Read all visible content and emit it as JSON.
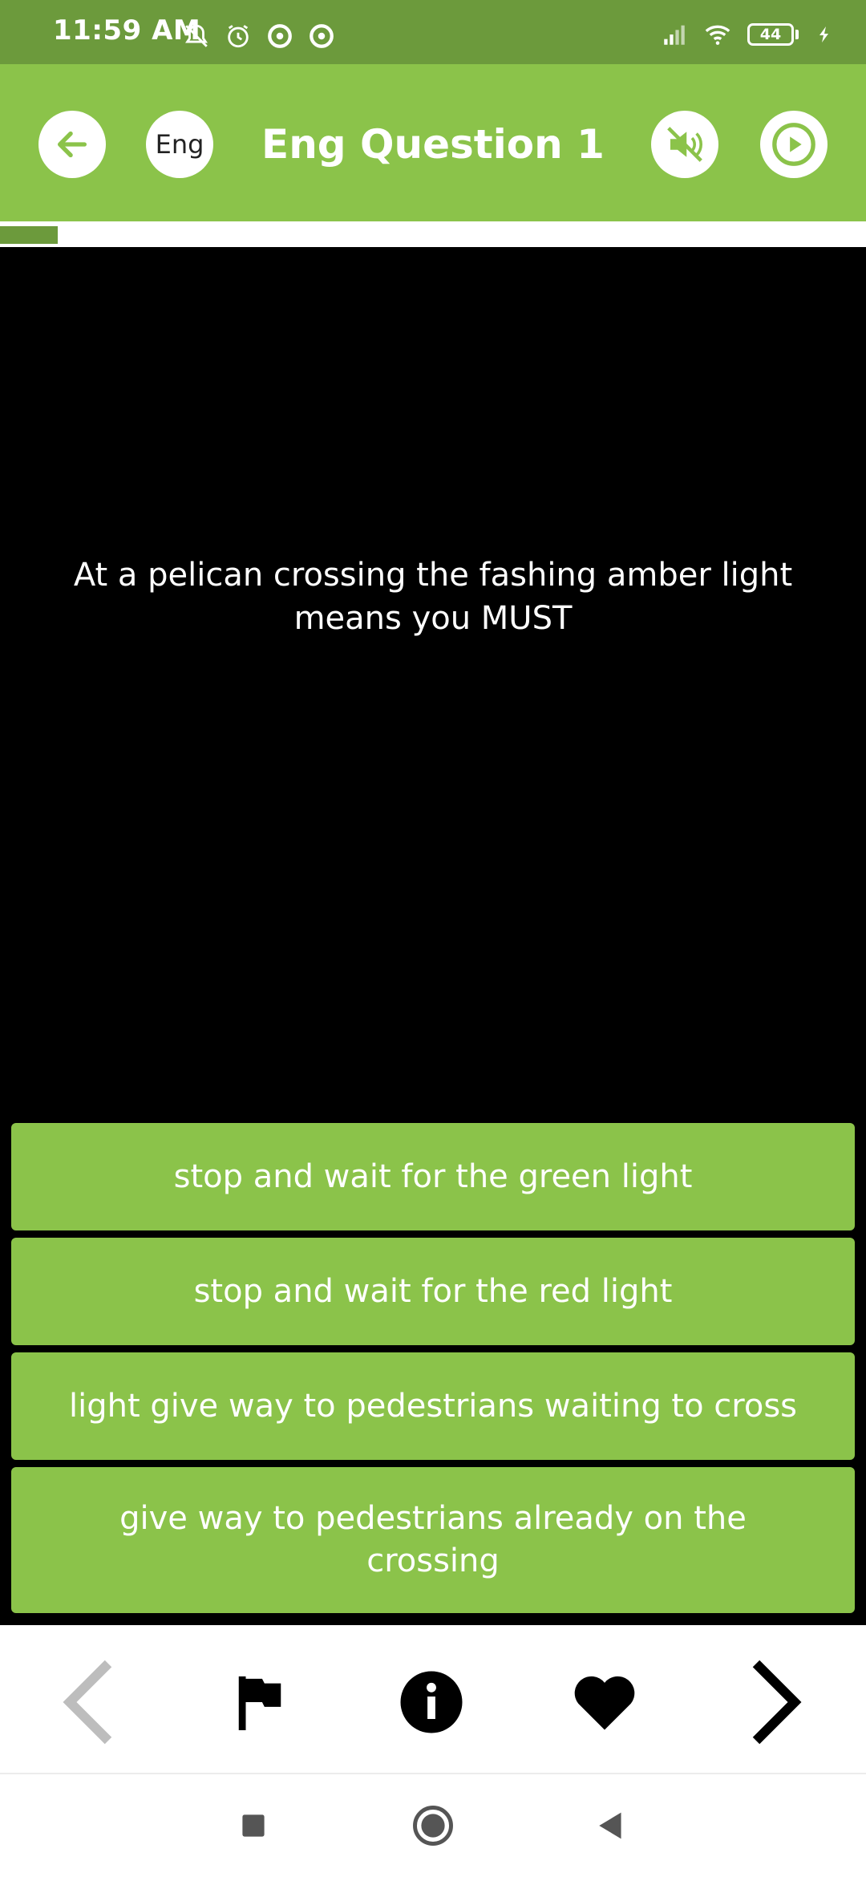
{
  "status_bar": {
    "time": "11:59 AM",
    "battery": "44",
    "left_icons": [
      "silent-icon",
      "alarm-icon",
      "data-saver-icon",
      "data-saver-icon"
    ],
    "right_icons": [
      "signal-icon",
      "wifi-icon",
      "battery-icon",
      "charging-icon"
    ]
  },
  "header": {
    "title": "Eng Question 1",
    "language_label": "Eng",
    "back_icon": "arrow-left-icon",
    "mute_icon": "speaker-muted-icon",
    "play_icon": "play-icon"
  },
  "progress": {
    "fraction": 0.067
  },
  "question": {
    "text": "At a pelican crossing the fashing amber light means you MUST"
  },
  "answers": [
    {
      "label": "stop and wait for the green light"
    },
    {
      "label": "stop and wait for the red light"
    },
    {
      "label": "light give way to pedestrians waiting to cross"
    },
    {
      "label": "give way to pedestrians already on the crossing"
    }
  ],
  "toolbar": {
    "items": [
      "previous-icon",
      "flag-icon",
      "info-icon",
      "heart-icon",
      "next-icon"
    ]
  },
  "colors": {
    "status_bar": "#6c9a3c",
    "app_bar": "#8bc34a",
    "answer_bg": "#8bc34a",
    "progress_fill": "#6c9a3c",
    "question_bg": "#000000"
  }
}
